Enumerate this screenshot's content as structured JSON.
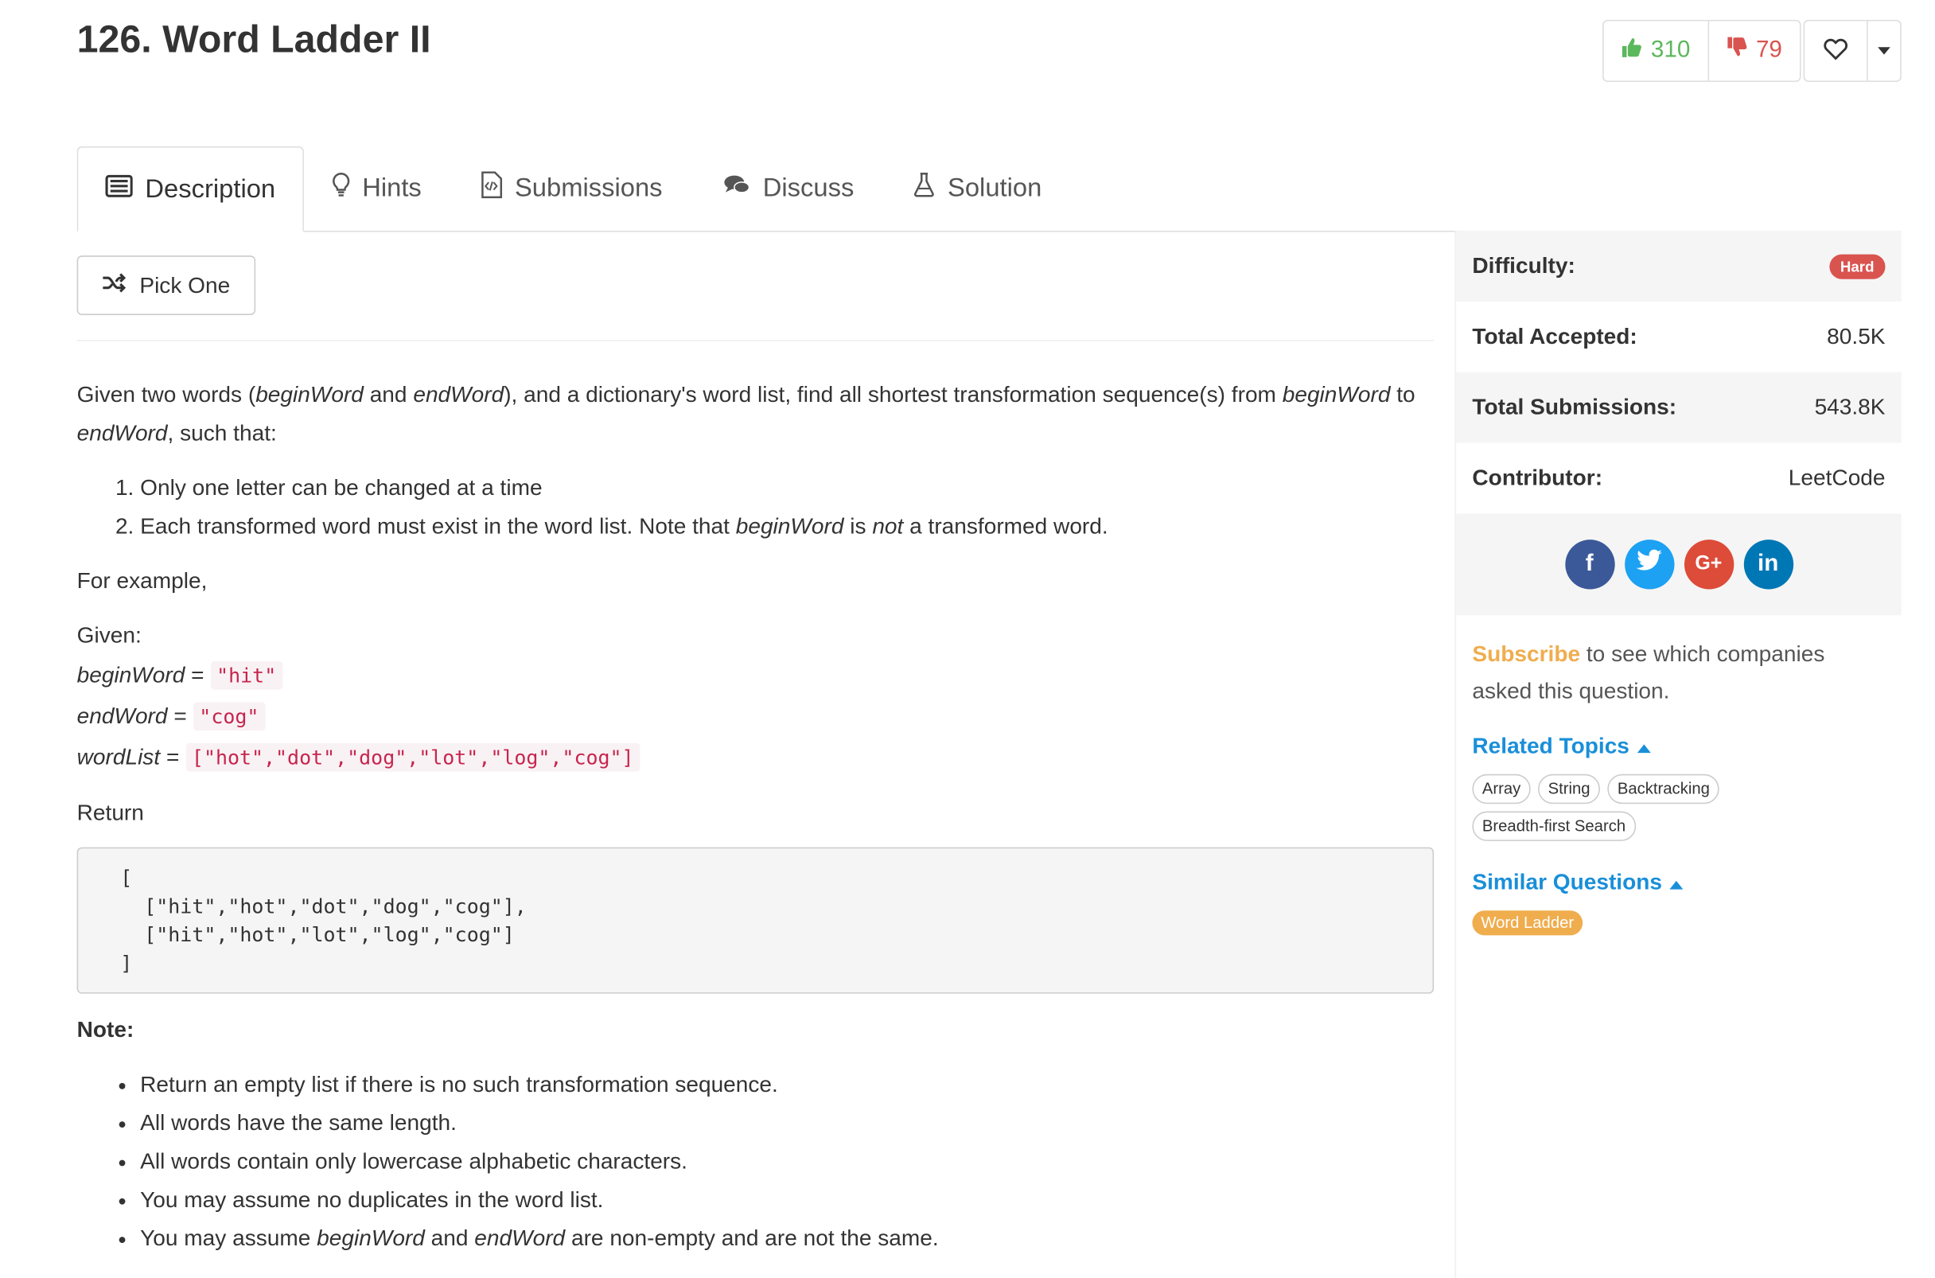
{
  "problem": {
    "title": "126. Word Ladder II"
  },
  "votes": {
    "up": "310",
    "down": "79"
  },
  "tabs": [
    {
      "label": "Description",
      "icon": "list-icon"
    },
    {
      "label": "Hints",
      "icon": "lightbulb-icon"
    },
    {
      "label": "Submissions",
      "icon": "code-file-icon"
    },
    {
      "label": "Discuss",
      "icon": "comments-icon"
    },
    {
      "label": "Solution",
      "icon": "flask-icon"
    }
  ],
  "pick_one": {
    "label": "Pick One"
  },
  "description": {
    "intro": {
      "p1": "Given two words (",
      "begin": "beginWord",
      "p2": " and ",
      "end": "endWord",
      "p3": "), and a dictionary's word list, find all shortest transformation sequence(s) from ",
      "begin2": "beginWord",
      "p4": " to ",
      "end2": "endWord",
      "p5": ", such that:"
    },
    "rules": {
      "r1": "Only one letter can be changed at a time",
      "r2a": "Each transformed word must exist in the word list. Note that ",
      "r2b": "beginWord",
      "r2c": " is ",
      "r2d": "not",
      "r2e": " a transformed word."
    },
    "for_example": "For example,",
    "given": "Given:",
    "vars": {
      "begin_label": "beginWord",
      "begin_value": "\"hit\"",
      "end_label": "endWord",
      "end_value": "\"cog\"",
      "list_label": "wordList",
      "list_value": "[\"hot\",\"dot\",\"dog\",\"lot\",\"log\",\"cog\"]",
      "equals": " = "
    },
    "return_label": "Return",
    "return_code": "[\n  [\"hit\",\"hot\",\"dot\",\"dog\",\"cog\"],\n  [\"hit\",\"hot\",\"lot\",\"log\",\"cog\"]\n]",
    "note_label": "Note:",
    "notes": {
      "n1": "Return an empty list if there is no such transformation sequence.",
      "n2": "All words have the same length.",
      "n3": "All words contain only lowercase alphabetic characters.",
      "n4": "You may assume no duplicates in the word list.",
      "n5a": "You may assume ",
      "n5b": "beginWord",
      "n5c": " and ",
      "n5d": "endWord",
      "n5e": " are non-empty and are not the same."
    }
  },
  "stats": {
    "difficulty_label": "Difficulty:",
    "difficulty_value": "Hard",
    "accepted_label": "Total Accepted:",
    "accepted_value": "80.5K",
    "submissions_label": "Total Submissions:",
    "submissions_value": "543.8K",
    "contributor_label": "Contributor:",
    "contributor_value": "LeetCode"
  },
  "social": {
    "fb": "f",
    "tw": "t",
    "gp": "G+",
    "li": "in"
  },
  "sidebar": {
    "subscribe": "Subscribe",
    "subscribe_rest": " to see which companies asked this question.",
    "related_label": "Related Topics",
    "related_topics": [
      "Array",
      "String",
      "Backtracking",
      "Breadth-first Search"
    ],
    "similar_label": "Similar Questions",
    "similar_questions": [
      "Word Ladder"
    ]
  },
  "colors": {
    "hard": "#d9534f",
    "upvote": "#5cb85c",
    "downvote": "#d9534f",
    "link": "#1a8fd9",
    "subscribe": "#f0ad4e"
  }
}
